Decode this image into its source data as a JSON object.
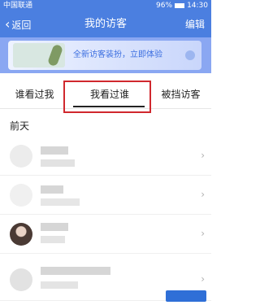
{
  "statusbar": {
    "carrier": "中国联通",
    "battery": "96%",
    "battery_level": 0.96,
    "time": "14:30"
  },
  "navbar": {
    "back_label": "返回",
    "title": "我的访客",
    "edit_label": "编辑"
  },
  "banner": {
    "text": "全新访客装扮，立即体验"
  },
  "tabs": [
    {
      "label": "谁看过我"
    },
    {
      "label": "我看过谁",
      "selected": true
    },
    {
      "label": "被挡访客"
    }
  ],
  "section": {
    "header": "前天"
  },
  "icons": {
    "back": "chevron-left-icon",
    "row_arrow": "chevron-right-icon"
  },
  "colors": {
    "accent": "#4b7fe0",
    "highlight": "#d0282e"
  }
}
